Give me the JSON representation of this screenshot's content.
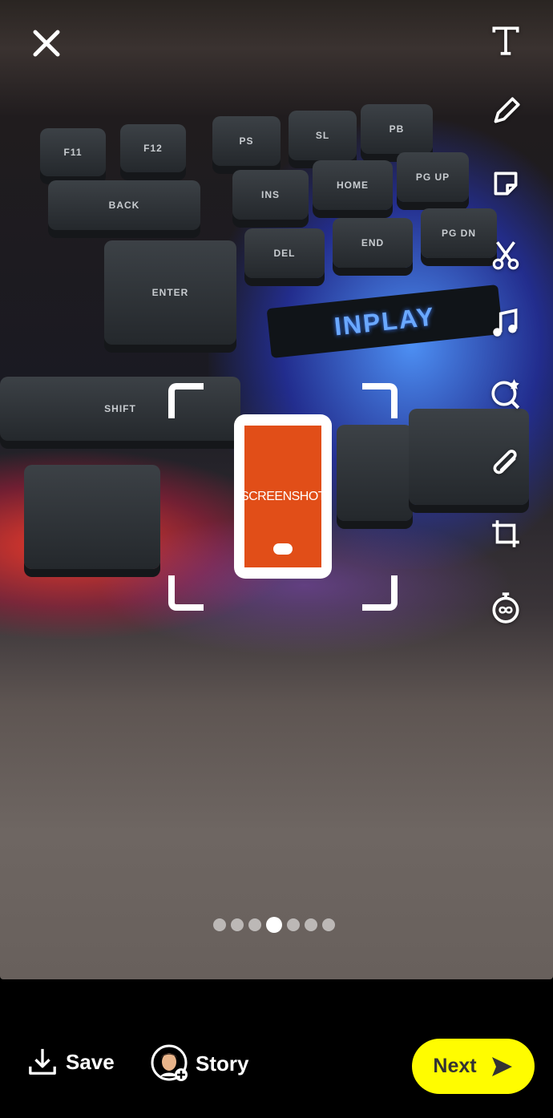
{
  "photo": {
    "keys": [
      "F11",
      "F12",
      "PS",
      "SL",
      "PB",
      "BACK",
      "ENTER",
      "INS",
      "HOME",
      "PG UP",
      "DEL",
      "END",
      "PG DN",
      "SHIFT"
    ],
    "brand": "INPLAY"
  },
  "sticker": {
    "label": "SCREENSHOT",
    "color": "#e14e18"
  },
  "toolbar": [
    "text-icon",
    "pencil-icon",
    "sticker-icon",
    "scissors-icon",
    "music-icon",
    "lens-icon",
    "paperclip-icon",
    "crop-icon",
    "timer-icon"
  ],
  "pager": {
    "count": 7,
    "active": 4
  },
  "bottom": {
    "save_label": "Save",
    "story_label": "Story",
    "next_label": "Next",
    "next_color": "#fffc00"
  }
}
